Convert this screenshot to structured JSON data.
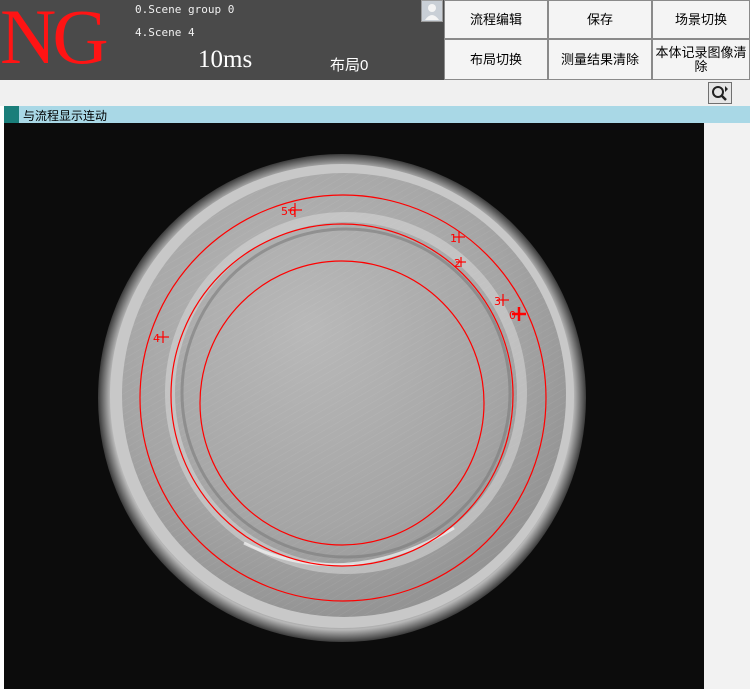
{
  "header": {
    "judgement": "NG",
    "scene_group": "0.Scene group 0",
    "scene": "4.Scene 4",
    "processing_time": "10ms",
    "layout_label": "布局0"
  },
  "buttons": {
    "flow_edit": "流程编辑",
    "save": "保存",
    "scene_switch": "场景切换",
    "layout_switch": "布局切换",
    "clear_results": "测量结果清除",
    "clear_images": "本体记录图像清除"
  },
  "display": {
    "link_text": "与流程显示连动"
  },
  "markers": [
    {
      "label": "5",
      "cross": "6"
    },
    {
      "label": "1"
    },
    {
      "label": "2"
    },
    {
      "label": "3"
    },
    {
      "label": "0"
    },
    {
      "label": "4"
    }
  ],
  "icons": {
    "user": "user-icon",
    "zoom": "zoom-magnifier-icon"
  },
  "colors": {
    "judgement": "#ff1414",
    "overlay": "#ff0000",
    "header_bg": "#4a4a4a",
    "link_bar": "#a9d8e6"
  }
}
